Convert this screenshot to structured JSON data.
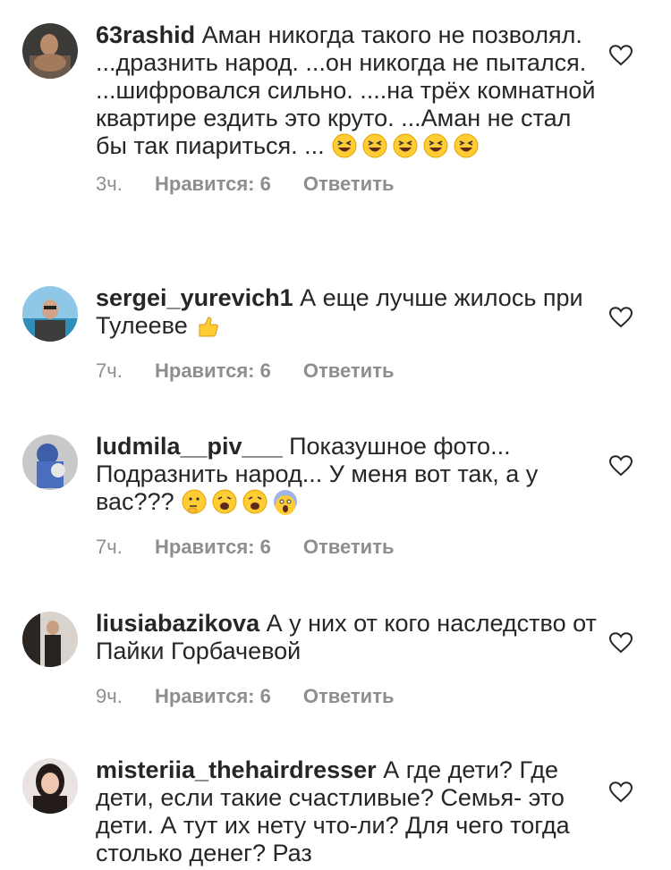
{
  "comments": [
    {
      "username": "63rashid",
      "text": "Аман никогда такого не позволял. ...дразнить народ. ...он никогда не пытался. ...шифровался сильно. ....на трёх комнатной квартире ездить это круто. ...Аман не стал бы так пиариться. ...",
      "emojis": [
        "laughing-emoji",
        "laughing-emoji",
        "laughing-emoji",
        "laughing-emoji",
        "laughing-emoji"
      ],
      "time": "3ч.",
      "likes": "Нравится: 6",
      "reply": "Ответить"
    },
    {
      "username": "sergei_yurevich1",
      "text": "А еще лучше жилось при Тулееве",
      "emojis": [
        "thumbs-up-emoji"
      ],
      "time": "7ч.",
      "likes": "Нравится: 6",
      "reply": "Ответить"
    },
    {
      "username": "ludmila__piv___",
      "text": "Показушное фото... Подразнить народ... У меня вот так, а у вас???",
      "emojis": [
        "thinking-emoji",
        "weary-emoji",
        "weary-emoji",
        "screaming-emoji"
      ],
      "time": "7ч.",
      "likes": "Нравится: 6",
      "reply": "Ответить"
    },
    {
      "username": "liusiabazikova",
      "text": "А у них от кого наследство от Пайки Горбачевой",
      "emojis": [],
      "time": "9ч.",
      "likes": "Нравится: 6",
      "reply": "Ответить"
    },
    {
      "username": "misteriia_thehairdresser",
      "text": "А где дети? Где дети, если такие счастливые? Семья- это дети. А тут их нету что-ли? Для чего тогда столько денег? Раз",
      "emojis": [],
      "time": "",
      "likes": "",
      "reply": ""
    }
  ],
  "colors": {
    "text": "#262626",
    "meta": "#8e8e8e",
    "background": "#ffffff",
    "emoji_yellow": "#ffcc33"
  }
}
